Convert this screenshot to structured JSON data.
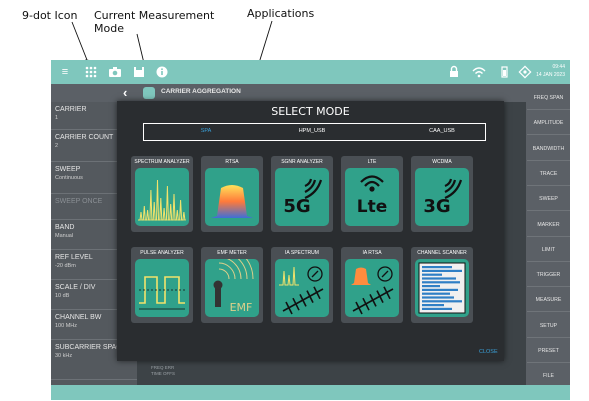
{
  "callouts": {
    "nine_dot": "9-dot Icon",
    "current_mode_line1": "Current Measurement",
    "current_mode_line2": "Mode",
    "applications": "Applications"
  },
  "topbar": {
    "date_time_line1": "09:44",
    "date_time_line2": "14 JAN 2023",
    "icons": [
      "menu-icon",
      "nine-dot-icon",
      "camera-icon",
      "save-icon",
      "info-icon",
      "lock-icon",
      "wifi-icon",
      "battery-icon",
      "settings-icon"
    ]
  },
  "titlebar": {
    "title": "CARRIER AGGREGATION"
  },
  "left_panel": [
    {
      "label": "CARRIER",
      "value": "1"
    },
    {
      "label": "CARRIER COUNT",
      "value": "2"
    },
    {
      "label": "SWEEP",
      "value": "Continuous"
    },
    {
      "label": "SWEEP ONCE",
      "value": ""
    },
    {
      "label": "BAND",
      "value": "Manual"
    },
    {
      "label": "REF LEVEL",
      "value": "-20 dBm"
    },
    {
      "label": "SCALE / DIV",
      "value": "10 dB"
    },
    {
      "label": "CHANNEL BW",
      "value": "100 MHz"
    },
    {
      "label": "SUBCARRIER SPACING",
      "value": "30 kHz"
    }
  ],
  "right_panel": [
    "FREQ SPAN",
    "AMPLITUDE",
    "BANDWIDTH",
    "TRACE",
    "SWEEP",
    "MARKER",
    "LIMIT",
    "TRIGGER",
    "MEASURE",
    "SETUP",
    "PRESET",
    "FILE"
  ],
  "bottom_info": {
    "line1": "FREQ ERR",
    "line2": "TIME OFFS"
  },
  "dialog": {
    "title": "SELECT MODE",
    "tabs": [
      "SPA",
      "HPM_USB",
      "CAA_USB"
    ],
    "active_tab": "SPA",
    "close_label": "CLOSE",
    "apps": [
      {
        "label": "SPECTRUM ANALYZER",
        "icon": "spectrum-analyzer-icon"
      },
      {
        "label": "RTSA",
        "icon": "rtsa-icon"
      },
      {
        "label": "SGNR ANALYZER",
        "icon": "5g-icon",
        "glyph": "5G"
      },
      {
        "label": "LTE",
        "icon": "lte-icon",
        "glyph": "Lte"
      },
      {
        "label": "WCDMA",
        "icon": "3g-icon",
        "glyph": "3G"
      },
      {
        "label": "PULSE ANALYZER",
        "icon": "pulse-analyzer-icon"
      },
      {
        "label": "EMF METER",
        "icon": "emf-meter-icon",
        "glyph": "EMF"
      },
      {
        "label": "IA SPECTRUM",
        "icon": "ia-spectrum-icon"
      },
      {
        "label": "IA RTSA",
        "icon": "ia-rtsa-icon"
      },
      {
        "label": "CHANNEL SCANNER",
        "icon": "channel-scanner-icon"
      }
    ]
  },
  "colors": {
    "accent_teal": "#7fc7bd",
    "tile_green": "#30a18a",
    "active_tab_blue": "#3aa0d8",
    "dark_panel": "#2a2d30"
  }
}
